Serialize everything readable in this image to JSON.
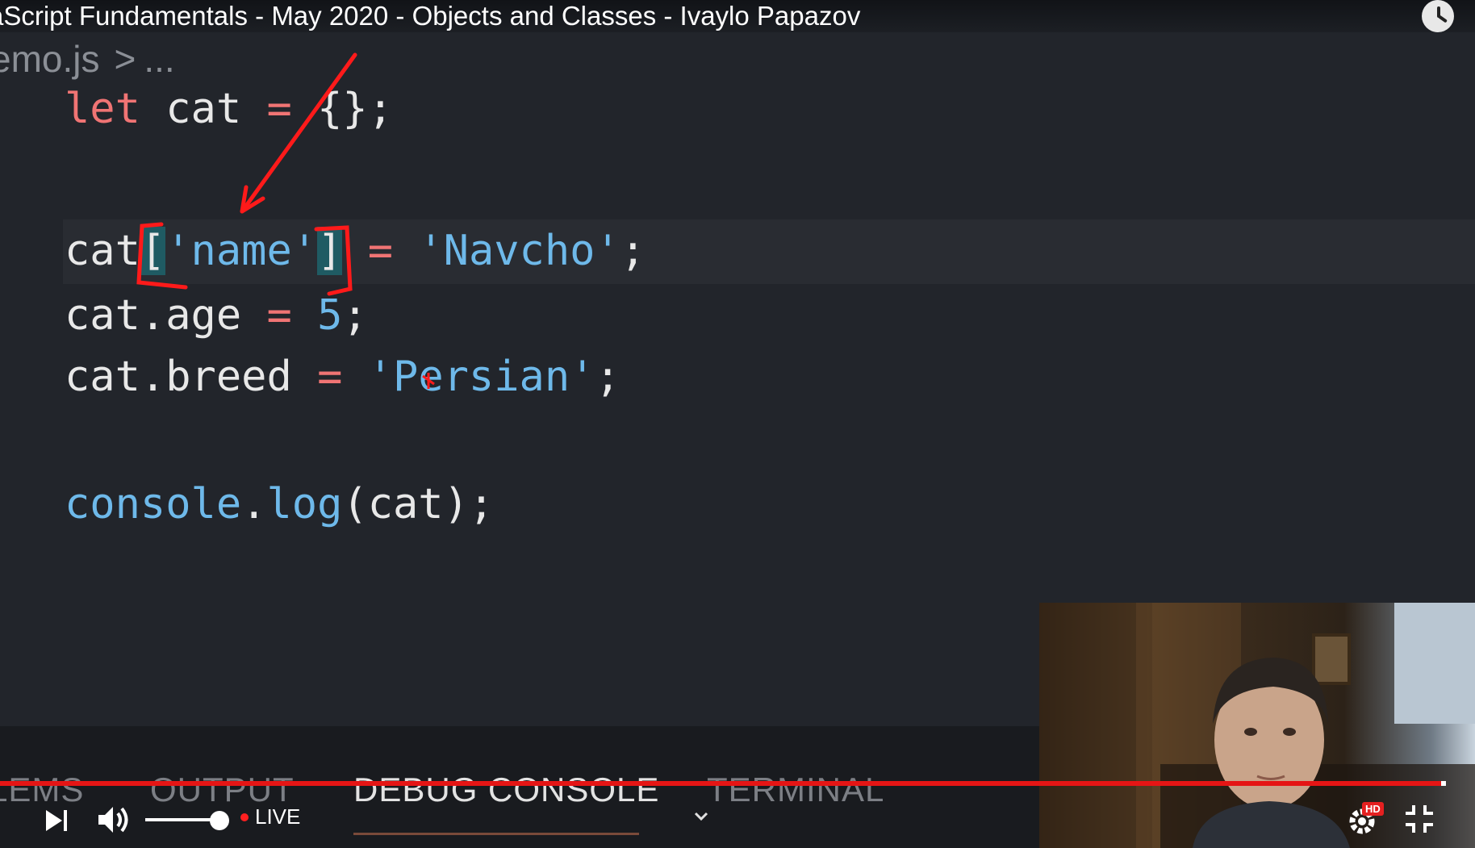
{
  "video": {
    "title": "aScript Fundamentals - May 2020 - Objects and Classes - Ivaylo Papazov",
    "watch_later_icon": "clock-icon"
  },
  "editor": {
    "breadcrumb": {
      "file": "emo.js",
      "separator": ">",
      "more": "..."
    },
    "lines": {
      "l1": {
        "kw": "let",
        "name": " cat ",
        "op": "=",
        "rest": " {};"
      },
      "l2": {
        "obj": "cat",
        "br_open": "[",
        "key": "'name'",
        "br_close": "]",
        "sp": " ",
        "op": "=",
        "sp2": " ",
        "str": "'Navcho'",
        "end": ";"
      },
      "l3": {
        "obj": "cat.age ",
        "op": "=",
        "sp": " ",
        "num": "5",
        "end": ";"
      },
      "l4": {
        "obj": "cat.breed ",
        "op": "=",
        "sp": " ",
        "str": "'Persian'",
        "end": ";"
      },
      "l5": {
        "fn1": "console",
        "dot": ".",
        "fn2": "log",
        "rest": "(cat);"
      }
    },
    "colors": {
      "keyword": "#f07474",
      "string": "#6eb9ea",
      "background": "#22252b",
      "annotation": "#ff1a1a"
    }
  },
  "panel": {
    "tabs": [
      "LEMS",
      "OUTPUT",
      "DEBUG CONSOLE",
      "TERMINAL"
    ],
    "active_tab": "DEBUG CONSOLE"
  },
  "player": {
    "live_label": "LIVE",
    "hd_label": "HD",
    "volume": 0.85,
    "progress": 0.98,
    "icons": [
      "next-icon",
      "volume-icon",
      "chevron-down-icon",
      "settings-icon",
      "exit-fullscreen-icon"
    ]
  }
}
